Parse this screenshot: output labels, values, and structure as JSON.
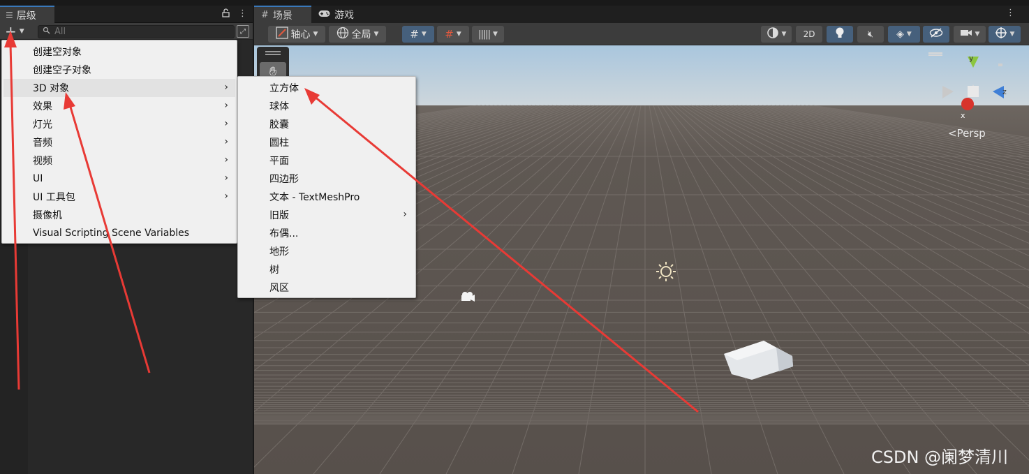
{
  "hierarchy": {
    "tab_title": "层级",
    "lock_icon": "lock-icon",
    "more_icon": "⋮",
    "add_icon": "+",
    "search_placeholder": "All"
  },
  "scene": {
    "tabs": [
      {
        "label": "场景",
        "icon": "grid-icon"
      },
      {
        "label": "游戏",
        "icon": "gamepad-icon"
      }
    ],
    "more_icon": "⋮",
    "toolbar": {
      "pivot_label": "轴心",
      "global_label": "全局",
      "mode_2d": "2D"
    },
    "persp_label": "<Persp",
    "gizmo_axes": {
      "y": "y",
      "x": "x",
      "z": "z"
    }
  },
  "main_menu": {
    "items": [
      {
        "label": "创建空对象",
        "submenu": false
      },
      {
        "label": "创建空子对象",
        "submenu": false
      },
      {
        "label": "3D 对象",
        "submenu": true,
        "highlighted": true
      },
      {
        "label": "效果",
        "submenu": true
      },
      {
        "label": "灯光",
        "submenu": true
      },
      {
        "label": "音频",
        "submenu": true
      },
      {
        "label": "视频",
        "submenu": true
      },
      {
        "label": "UI",
        "submenu": true
      },
      {
        "label": "UI 工具包",
        "submenu": true
      },
      {
        "label": "摄像机",
        "submenu": false
      },
      {
        "label": "Visual Scripting Scene Variables",
        "submenu": false
      }
    ]
  },
  "sub_menu": {
    "items": [
      {
        "label": "立方体",
        "submenu": false
      },
      {
        "label": "球体",
        "submenu": false
      },
      {
        "label": "胶囊",
        "submenu": false
      },
      {
        "label": "圆柱",
        "submenu": false
      },
      {
        "label": "平面",
        "submenu": false
      },
      {
        "label": "四边形",
        "submenu": false
      },
      {
        "label": "文本 - TextMeshPro",
        "submenu": false
      },
      {
        "label": "旧版",
        "submenu": true
      },
      {
        "label": "布偶...",
        "submenu": false
      },
      {
        "label": "地形",
        "submenu": false
      },
      {
        "label": "树",
        "submenu": false
      },
      {
        "label": "风区",
        "submenu": false
      }
    ]
  },
  "watermark": "CSDN @阑梦清川",
  "colors": {
    "accent": "#3a79bb",
    "annotation": "#e83a35",
    "menu_bg": "#f0f0f0",
    "ground": "#5e5752",
    "sky": "#b9cfe0"
  }
}
